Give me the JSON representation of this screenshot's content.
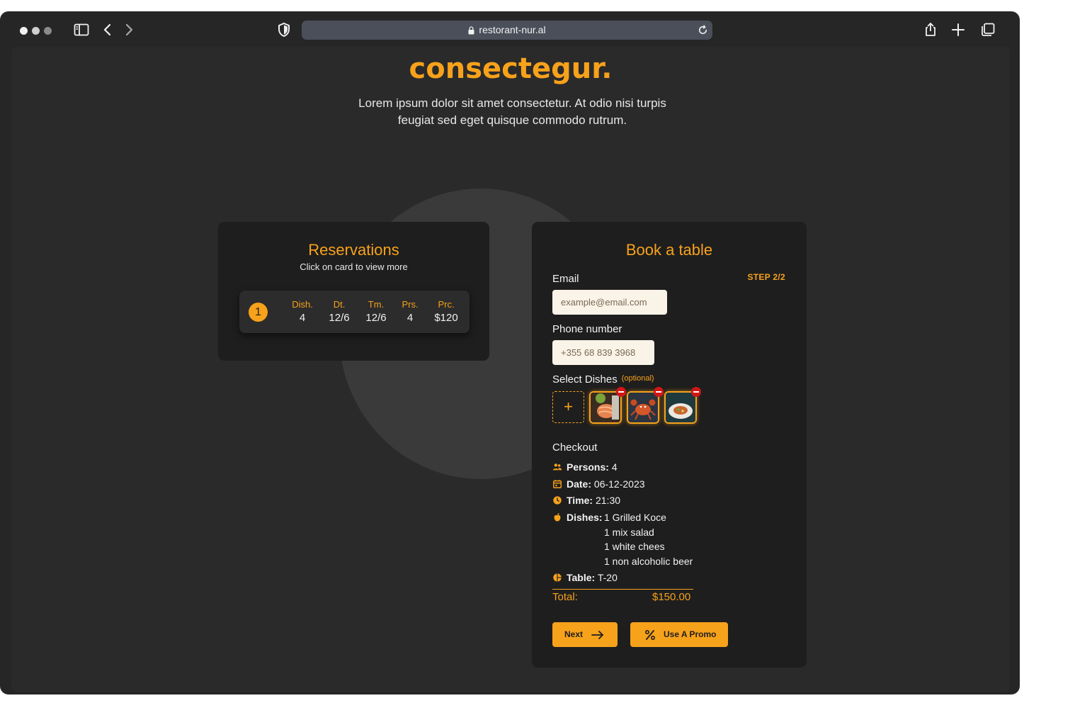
{
  "browser": {
    "url": "restorant-nur.al"
  },
  "hero": {
    "headline": "consectegur.",
    "subtext": "Lorem ipsum dolor sit amet consectetur. At odio nisi turpis feugiat sed eget quisque commodo rutrum."
  },
  "reservations": {
    "title": "Reservations",
    "subtitle": "Click on card to view more",
    "items": [
      {
        "number": "1",
        "columns": [
          {
            "header": "Dish.",
            "value": "4"
          },
          {
            "header": "Dt.",
            "value": "12/6"
          },
          {
            "header": "Tm.",
            "value": "12/6"
          },
          {
            "header": "Prs.",
            "value": "4"
          },
          {
            "header": "Prc.",
            "value": "$120"
          }
        ]
      }
    ]
  },
  "booking": {
    "title": "Book a table",
    "step": "STEP 2/2",
    "email_label": "Email",
    "email_placeholder": "example@email.com",
    "phone_label": "Phone number",
    "phone_placeholder": "+355 68 839 3968",
    "dishes_label": "Select Dishes",
    "dishes_optional": "(optional)",
    "add_dish_symbol": "+",
    "selected_dishes": [
      "salmon-dish",
      "crab-dish",
      "soup-dish"
    ],
    "checkout": {
      "title": "Checkout",
      "persons_label": "Persons:",
      "persons_value": "4",
      "date_label": "Date:",
      "date_value": "06-12-2023",
      "time_label": "Time:",
      "time_value": "21:30",
      "dishes_label": "Dishes:",
      "dishes": [
        "1 Grilled Koce",
        "1 mix salad",
        "1 white chees",
        "1 non alcoholic beer"
      ],
      "table_label": "Table:",
      "table_value": "T-20",
      "total_label": "Total:",
      "total_value": "$150.00"
    },
    "next_label": "Next",
    "promo_label": "Use A Promo"
  },
  "colors": {
    "accent": "#f7a21b",
    "background": "#2a2a2a",
    "card": "#1e1e1e",
    "remove": "#d11616"
  }
}
